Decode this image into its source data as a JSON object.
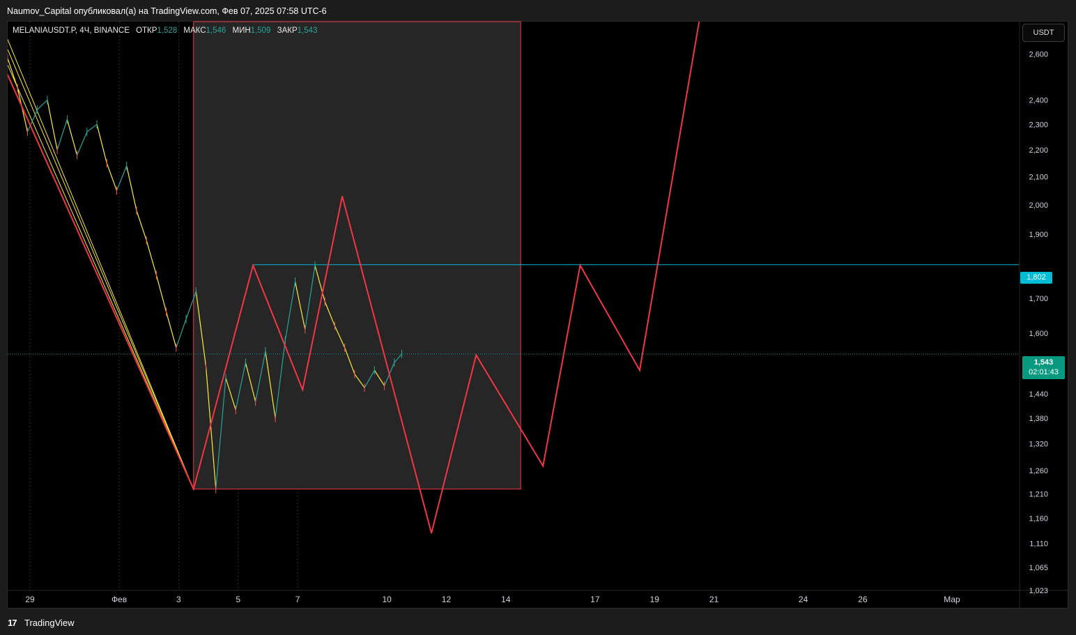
{
  "header": {
    "text": "Naumov_Capital опубликовал(а) на TradingView.com, Фев 07, 2025 07:58 UTC-6"
  },
  "legend": {
    "symbol": "MELANIAUSDT.P, 4Ч, BINANCE",
    "open_label": "ОТКР",
    "open": "1,528",
    "high_label": "МАКС",
    "high": "1,546",
    "low_label": "МИН",
    "low": "1,509",
    "close_label": "ЗАКР",
    "close": "1,543"
  },
  "currency_button": "USDT",
  "price_tag": {
    "price": "1,543",
    "countdown": "02:01:43",
    "color": "#089981"
  },
  "level_tag": {
    "price": "1,802",
    "color": "#00bcd4"
  },
  "footer": {
    "brand": "TradingView"
  },
  "colors": {
    "up": "#26a69a",
    "down": "#ef5350",
    "projection": "#f23645",
    "channel": "#ffeb3b",
    "box_border": "#f23645",
    "box_fill": "#262626",
    "level_line": "#00bcd4"
  },
  "chart_data": {
    "type": "line",
    "title": "",
    "y_scale": "log",
    "y_range": [
      1.023,
      2.75
    ],
    "x_range": [
      "2025-01-28T06:00",
      "2025-03-03T06:00"
    ],
    "y_ticks": [
      "2,600",
      "2,400",
      "2,300",
      "2,200",
      "2,100",
      "2,000",
      "1,900",
      "1,700",
      "1,600",
      "1,440",
      "1,380",
      "1,320",
      "1,260",
      "1,210",
      "1,160",
      "1,110",
      "1,065",
      "1,023"
    ],
    "x_ticks": [
      {
        "label": "29",
        "date": "2025-01-29T00:00"
      },
      {
        "label": "Фев",
        "date": "2025-02-01T00:00"
      },
      {
        "label": "3",
        "date": "2025-02-03T00:00"
      },
      {
        "label": "5",
        "date": "2025-02-05T00:00"
      },
      {
        "label": "7",
        "date": "2025-02-07T00:00"
      },
      {
        "label": "10",
        "date": "2025-02-10T00:00"
      },
      {
        "label": "12",
        "date": "2025-02-12T00:00"
      },
      {
        "label": "14",
        "date": "2025-02-14T00:00"
      },
      {
        "label": "17",
        "date": "2025-02-17T00:00"
      },
      {
        "label": "19",
        "date": "2025-02-19T00:00"
      },
      {
        "label": "21",
        "date": "2025-02-21T00:00"
      },
      {
        "label": "24",
        "date": "2025-02-24T00:00"
      },
      {
        "label": "26",
        "date": "2025-02-26T00:00"
      },
      {
        "label": "Мар",
        "date": "2025-03-01T00:00"
      }
    ],
    "last_price": 1.543,
    "level": 1.802,
    "price_path": [
      [
        "2025-01-28T06:00",
        2.58
      ],
      [
        "2025-01-28T14:00",
        2.45
      ],
      [
        "2025-01-28T22:00",
        2.27
      ],
      [
        "2025-01-29T06:00",
        2.36
      ],
      [
        "2025-01-29T14:00",
        2.4
      ],
      [
        "2025-01-29T22:00",
        2.2
      ],
      [
        "2025-01-30T06:00",
        2.32
      ],
      [
        "2025-01-30T14:00",
        2.18
      ],
      [
        "2025-01-30T22:00",
        2.27
      ],
      [
        "2025-01-31T06:00",
        2.3
      ],
      [
        "2025-01-31T14:00",
        2.15
      ],
      [
        "2025-01-31T22:00",
        2.05
      ],
      [
        "2025-02-01T06:00",
        2.14
      ],
      [
        "2025-02-01T14:00",
        1.98
      ],
      [
        "2025-02-01T22:00",
        1.88
      ],
      [
        "2025-02-02T06:00",
        1.77
      ],
      [
        "2025-02-02T14:00",
        1.66
      ],
      [
        "2025-02-02T22:00",
        1.56
      ],
      [
        "2025-02-03T06:00",
        1.64
      ],
      [
        "2025-02-03T14:00",
        1.72
      ],
      [
        "2025-02-03T22:00",
        1.51
      ],
      [
        "2025-02-04T06:00",
        1.22
      ],
      [
        "2025-02-04T14:00",
        1.48
      ],
      [
        "2025-02-04T22:00",
        1.4
      ],
      [
        "2025-02-05T06:00",
        1.52
      ],
      [
        "2025-02-05T14:00",
        1.42
      ],
      [
        "2025-02-05T22:00",
        1.55
      ],
      [
        "2025-02-06T06:00",
        1.38
      ],
      [
        "2025-02-06T14:00",
        1.58
      ],
      [
        "2025-02-06T22:00",
        1.75
      ],
      [
        "2025-02-07T06:00",
        1.61
      ],
      [
        "2025-02-07T14:00",
        1.8
      ],
      [
        "2025-02-07T22:00",
        1.69
      ],
      [
        "2025-02-08T06:00",
        1.62
      ],
      [
        "2025-02-08T14:00",
        1.56
      ],
      [
        "2025-02-08T22:00",
        1.49
      ],
      [
        "2025-02-09T06:00",
        1.455
      ],
      [
        "2025-02-09T14:00",
        1.5
      ],
      [
        "2025-02-09T22:00",
        1.46
      ],
      [
        "2025-02-10T06:00",
        1.52
      ],
      [
        "2025-02-10T12:00",
        1.543
      ]
    ],
    "projection_path": [
      [
        "2025-01-28T00:00",
        2.58
      ],
      [
        "2025-02-03T12:00",
        1.22
      ],
      [
        "2025-02-05T12:00",
        1.8
      ],
      [
        "2025-02-07T04:00",
        1.45
      ],
      [
        "2025-02-08T12:00",
        2.03
      ],
      [
        "2025-02-11T12:00",
        1.13
      ],
      [
        "2025-02-13T00:00",
        1.54
      ],
      [
        "2025-02-15T06:00",
        1.27
      ],
      [
        "2025-02-16T12:00",
        1.8
      ],
      [
        "2025-02-18T12:00",
        1.5
      ],
      [
        "2025-02-20T12:00",
        2.75
      ]
    ],
    "channel_lines": [
      [
        [
          "2025-01-28T00:00",
          2.75
        ],
        [
          "2025-02-03T12:00",
          1.22
        ]
      ],
      [
        [
          "2025-01-28T06:00",
          2.62
        ],
        [
          "2025-02-03T12:00",
          1.22
        ]
      ],
      [
        [
          "2025-01-28T06:00",
          2.55
        ],
        [
          "2025-02-03T12:00",
          1.22
        ]
      ]
    ],
    "box": {
      "x_start": "2025-02-03T12:00",
      "x_end": "2025-02-14T12:00",
      "y_low": 1.22,
      "y_high": 2.75
    }
  }
}
